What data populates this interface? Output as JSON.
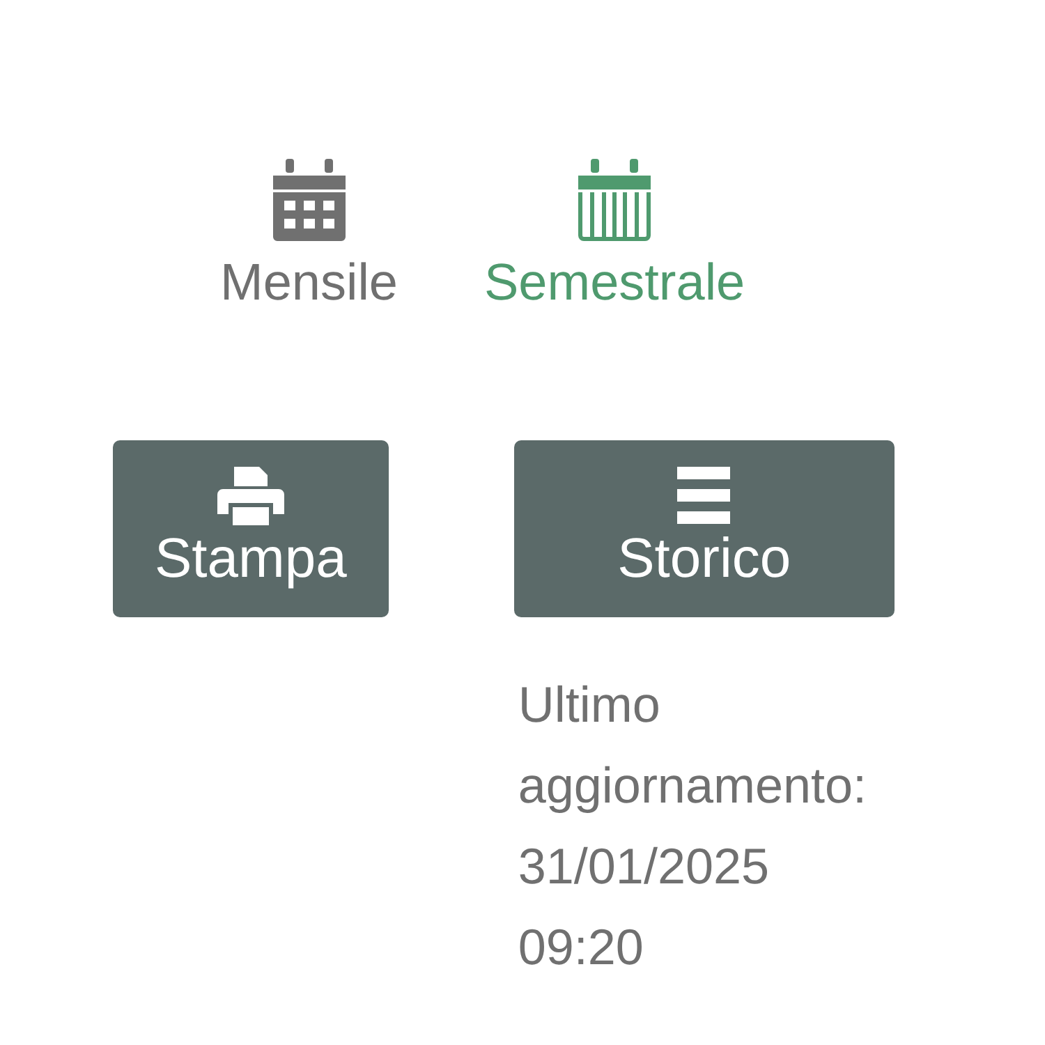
{
  "views": [
    {
      "label": "Mensile",
      "kind": "month",
      "selected": false
    },
    {
      "label": "Semestrale",
      "kind": "semester",
      "selected": true
    }
  ],
  "buttons": [
    {
      "label": "Stampa",
      "kind": "print"
    },
    {
      "label": "Storico",
      "kind": "history"
    }
  ],
  "last_update": "Ultimo aggiornamento: 31/01/2025 09:20"
}
